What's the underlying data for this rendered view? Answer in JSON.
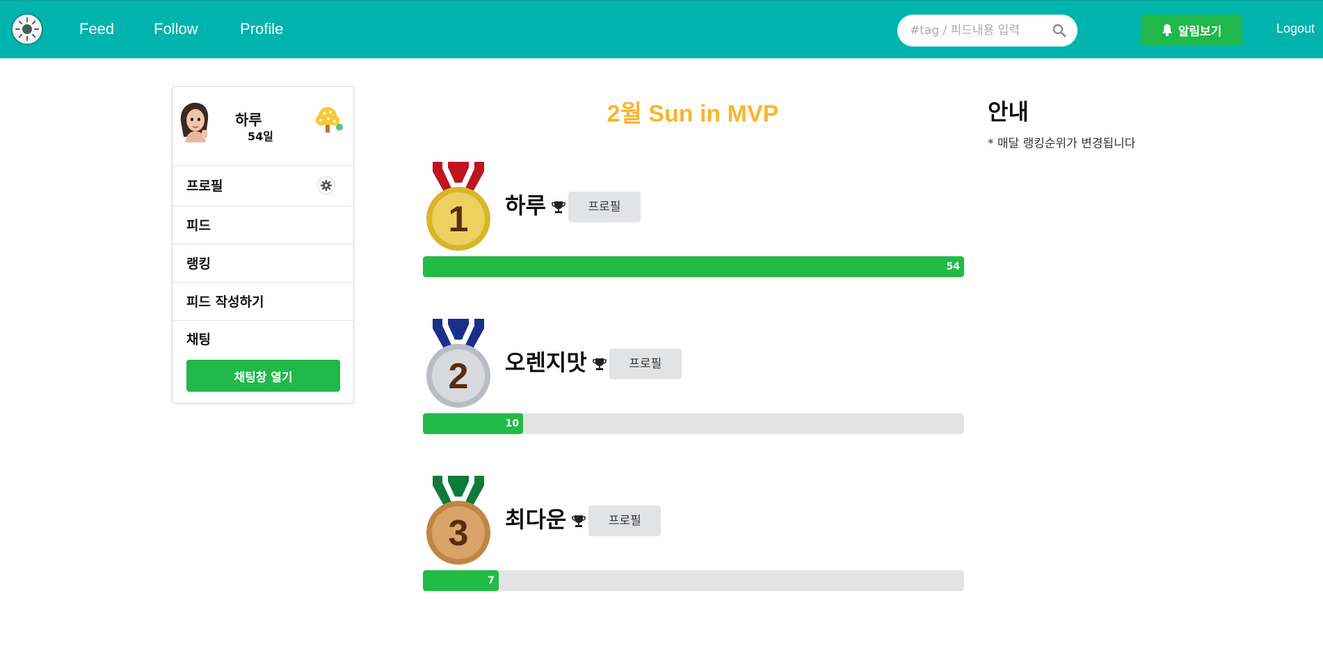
{
  "nav": {
    "links": [
      "Feed",
      "Follow",
      "Profile"
    ],
    "search_placeholder": "#tag / 피드내용 입력",
    "alarm_label": "알림보기",
    "logout_label": "Logout"
  },
  "sidebar": {
    "user_name": "하루",
    "user_days": "54일",
    "items": [
      {
        "label": "프로필"
      },
      {
        "label": "피드"
      },
      {
        "label": "랭킹"
      },
      {
        "label": "피드 작성하기"
      },
      {
        "label": "채팅"
      }
    ],
    "chat_button": "채팅창 열기"
  },
  "ranking": {
    "title": "2월 Sun in MVP",
    "max_value": 54,
    "entries": [
      {
        "rank": "1",
        "name": "하루",
        "value": 54,
        "value_label": "54",
        "button": "프로필",
        "ribbon_color": "#c0141e",
        "medal_color": "#d9b52a"
      },
      {
        "rank": "2",
        "name": "오렌지맛",
        "value": 10,
        "value_label": "10",
        "button": "프로필",
        "ribbon_color": "#1a2f8a",
        "medal_color": "#b9bcc2"
      },
      {
        "rank": "3",
        "name": "최다운",
        "value": 7,
        "value_label": "7",
        "button": "프로필",
        "ribbon_color": "#0f7a3a",
        "medal_color": "#c08544"
      }
    ]
  },
  "notice": {
    "title": "안내",
    "text": "* 매달 랭킹순위가 변경됩니다"
  },
  "colors": {
    "navbar": "#00b4ae",
    "accent_green": "#20b84a",
    "title_orange": "#fbb42c"
  }
}
